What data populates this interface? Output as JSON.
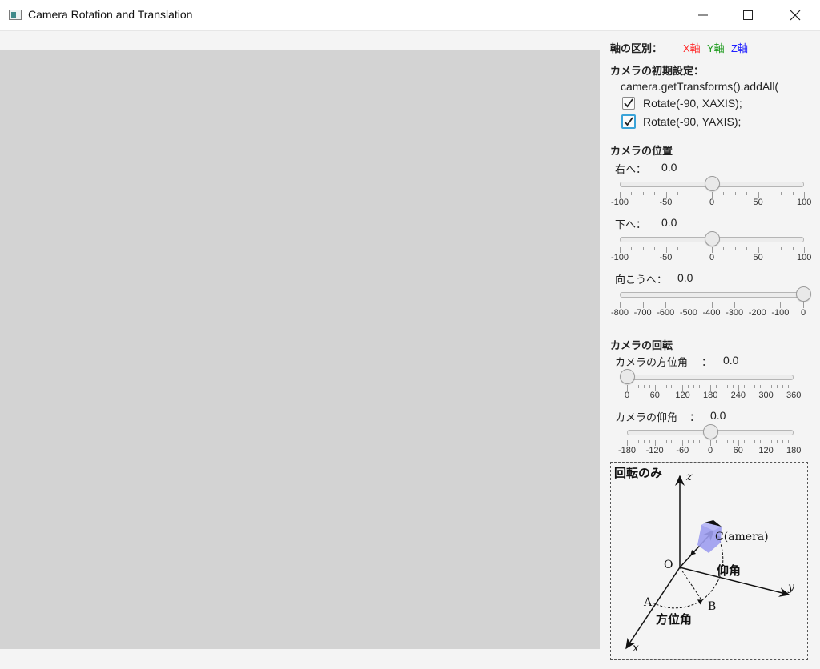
{
  "window": {
    "title": "Camera Rotation and Translation"
  },
  "axes_legend": {
    "label": "軸の区別：",
    "x": {
      "text": "X軸",
      "color": "#ff2a2a"
    },
    "y": {
      "text": "Y軸",
      "color": "#1a9a1a"
    },
    "z": {
      "text": "Z軸",
      "color": "#2222ff"
    }
  },
  "initial_settings": {
    "heading": "カメラの初期設定：",
    "code": "camera.getTransforms().addAll(",
    "rotate_x": {
      "label": "Rotate(-90, XAXIS);",
      "checked": true
    },
    "rotate_y": {
      "label": "Rotate(-90, YAXIS);",
      "checked": true
    }
  },
  "position": {
    "heading": "カメラの位置",
    "right": {
      "label": "右へ：",
      "value": "0.0",
      "min": -100,
      "max": 100,
      "current": 0,
      "tick_labels": [
        "-100",
        "-50",
        "0",
        "50",
        "100"
      ]
    },
    "down": {
      "label": "下へ：",
      "value": "0.0",
      "min": -100,
      "max": 100,
      "current": 0,
      "tick_labels": [
        "-100",
        "-50",
        "0",
        "50",
        "100"
      ]
    },
    "forward": {
      "label": "向こうへ：",
      "value": "0.0",
      "min": -800,
      "max": 0,
      "current": 0,
      "tick_labels": [
        "-800",
        "-700",
        "-600",
        "-500",
        "-400",
        "-300",
        "-200",
        "-100",
        "0"
      ]
    }
  },
  "rotation": {
    "heading": "カメラの回転",
    "azimuth": {
      "label": "カメラの方位角",
      "colon": "：",
      "value": "0.0",
      "min": 0,
      "max": 360,
      "current": 0,
      "tick_labels": [
        "0",
        "60",
        "120",
        "180",
        "240",
        "300",
        "360"
      ]
    },
    "elevation": {
      "label": "カメラの仰角",
      "colon": "：",
      "value": "0.0",
      "min": -180,
      "max": 180,
      "current": 0,
      "tick_labels": [
        "-180",
        "-120",
        "-60",
        "0",
        "60",
        "120",
        "180"
      ]
    }
  },
  "diagram": {
    "title": "回転のみ",
    "z_label": "z",
    "y_label": "y",
    "x_label": "x",
    "origin_label": "O",
    "camera_label": "C(amera)",
    "elevation_label": "仰角",
    "azimuth_label": "方位角",
    "a_label": "A",
    "b_label": "B"
  }
}
